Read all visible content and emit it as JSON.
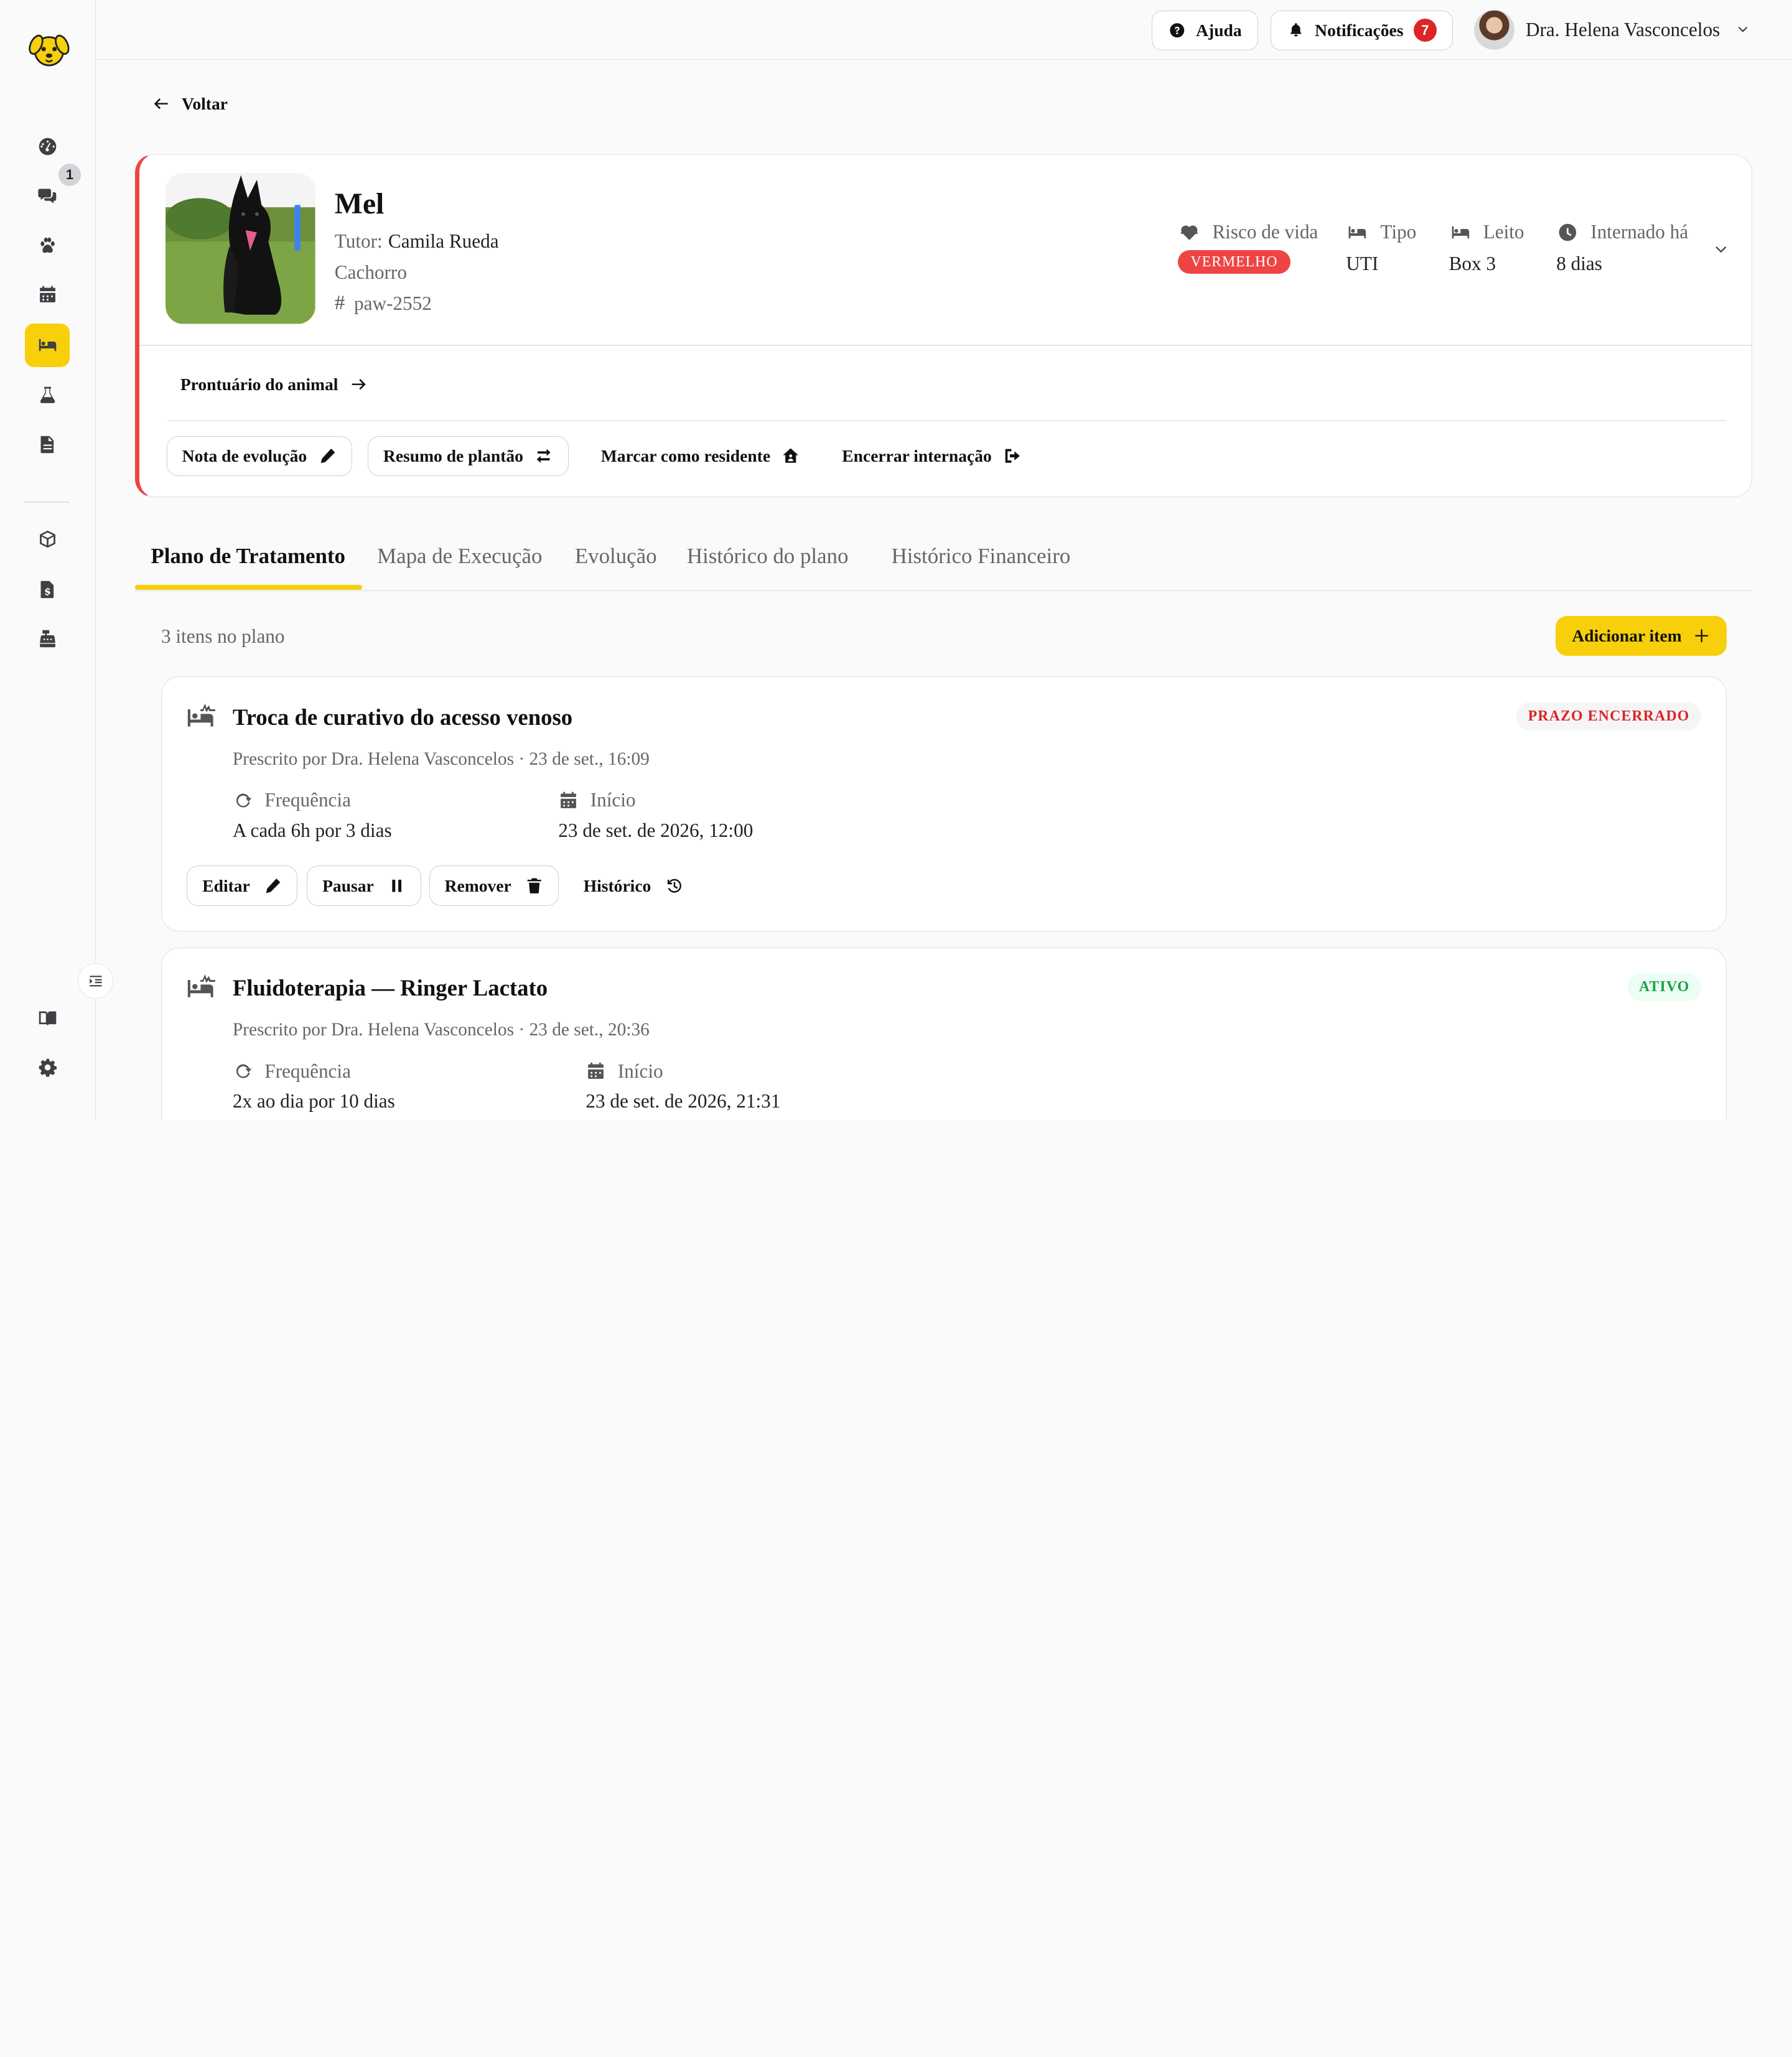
{
  "app": {
    "logo_icon": "dog-logo",
    "accent_color": "#f7cf0b"
  },
  "sidebar": {
    "items": [
      {
        "icon": "dashboard-icon"
      },
      {
        "icon": "chat-icon",
        "badge": "1"
      },
      {
        "icon": "paw-icon"
      },
      {
        "icon": "calendar-icon"
      },
      {
        "icon": "bed-icon",
        "active": true
      },
      {
        "icon": "flask-icon"
      },
      {
        "icon": "document-icon"
      },
      {
        "icon": "box-icon"
      },
      {
        "icon": "invoice-icon"
      },
      {
        "icon": "cash-register-icon"
      },
      {
        "icon": "book-icon"
      },
      {
        "icon": "gear-icon"
      }
    ]
  },
  "topbar": {
    "help_label": "Ajuda",
    "notifications_label": "Notificações",
    "notifications_count": "7",
    "user_name": "Dra. Helena Vasconcelos"
  },
  "nav": {
    "back_label": "Voltar"
  },
  "patient": {
    "name": "Mel",
    "tutor_label": "Tutor:",
    "tutor_name": "Camila Rueda",
    "species": "Cachorro",
    "id_symbol": "#",
    "id": "paw-2552",
    "risk_label": "Risco de vida",
    "risk_value": "VERMELHO",
    "risk_color": "#ef4444",
    "type_label": "Tipo",
    "type_value": "UTI",
    "bed_label": "Leito",
    "bed_value": "Box 3",
    "admitted_label": "Internado há",
    "admitted_value": "8 dias",
    "records_link": "Prontuário do animal",
    "actions": {
      "evolution_note": "Nota de evolução",
      "shift_summary": "Resumo de plantão",
      "mark_resident": "Marcar como residente",
      "end_hospitalization": "Encerrar internação"
    }
  },
  "tabs": [
    {
      "label": "Plano de Tratamento",
      "active": true
    },
    {
      "label": "Mapa de Execução"
    },
    {
      "label": "Evolução"
    },
    {
      "label": "Histórico do plano"
    },
    {
      "label": "Histórico Financeiro"
    }
  ],
  "plan": {
    "count_text": "3 itens no plano",
    "add_label": "Adicionar item",
    "items": [
      {
        "title": "Troca de curativo do acesso venoso",
        "status": "PRAZO ENCERRADO",
        "meta": "Prescrito por Dra. Helena Vasconcelos · 23 de set., 16:09",
        "frequency_label": "Frequência",
        "frequency_value": "A cada 6h por 3 dias",
        "start_label": "Início",
        "start_value": "23 de set. de 2026, 12:00",
        "actions": {
          "edit": "Editar",
          "pause": "Pausar",
          "remove": "Remover",
          "history": "Histórico"
        }
      },
      {
        "title": "Fluidoterapia — Ringer Lactato",
        "status": "ATIVO",
        "meta": "Prescrito por Dra. Helena Vasconcelos · 23 de set., 20:36",
        "frequency_label": "Frequência",
        "frequency_value": "2x ao dia por 10 dias",
        "start_label": "Início",
        "start_value": "23 de set. de 2026, 21:31"
      }
    ]
  }
}
